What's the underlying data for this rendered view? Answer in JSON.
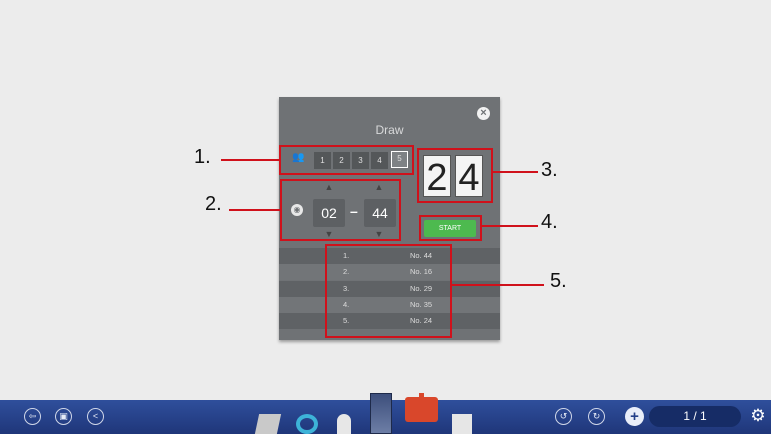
{
  "dialog": {
    "title": "Draw",
    "close_icon": "close-icon",
    "groups": {
      "icon": "people-icon",
      "options": [
        "1",
        "2",
        "3",
        "4",
        "5"
      ],
      "selected": "5"
    },
    "range": {
      "icon": "palette-icon",
      "from": "02",
      "separator": "–",
      "to": "44"
    },
    "result_digits": [
      "2",
      "4"
    ],
    "start_label": "START",
    "results": [
      {
        "index": "1.",
        "value": "No. 44"
      },
      {
        "index": "2.",
        "value": "No. 16"
      },
      {
        "index": "3.",
        "value": "No. 29"
      },
      {
        "index": "4.",
        "value": "No. 35"
      },
      {
        "index": "5.",
        "value": "No. 24"
      }
    ]
  },
  "annotations": [
    "1.",
    "2.",
    "3.",
    "4.",
    "5."
  ],
  "taskbar": {
    "page_indicator": "1 / 1",
    "add_page_label": "+",
    "colors": {
      "bar": "#2a4892",
      "accent_red": "#d0111b",
      "start_green": "#4dba4f"
    }
  }
}
